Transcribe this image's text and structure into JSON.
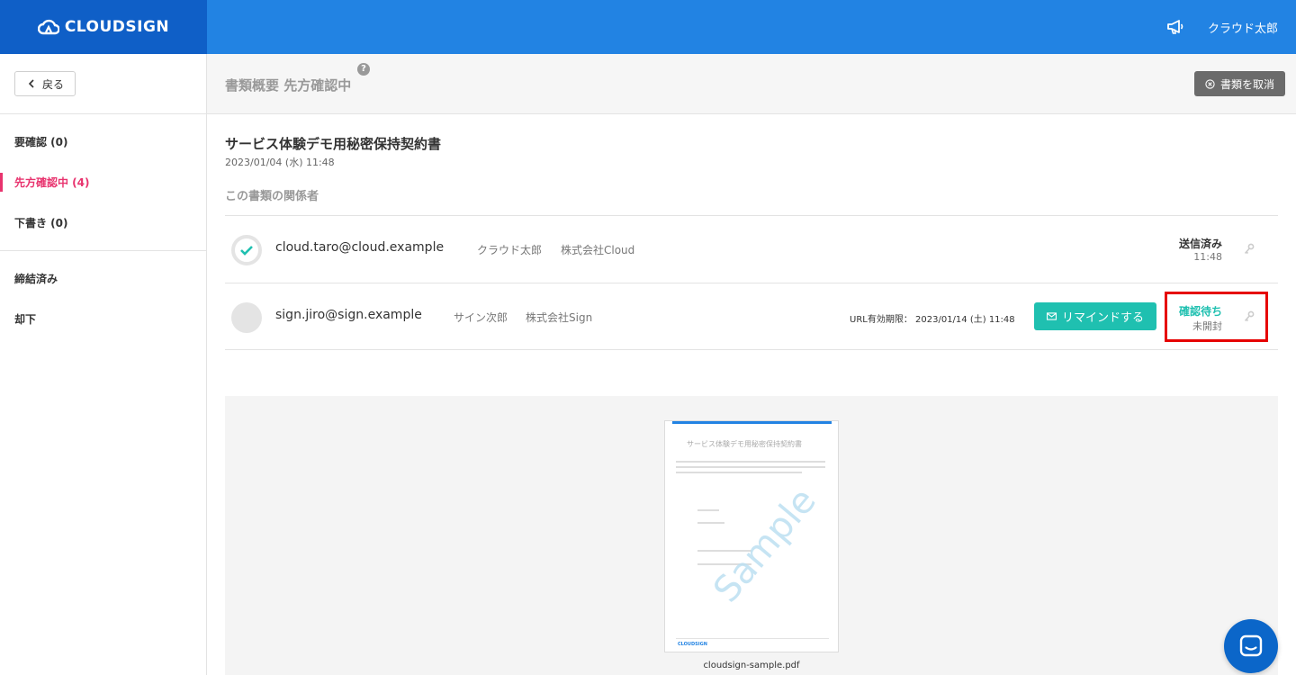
{
  "app": {
    "logo_text": "CLOUDSIGN",
    "user_name": "クラウド太郎"
  },
  "sidebar": {
    "back_label": "戻る",
    "items": [
      {
        "label": "要確認 (0)",
        "active": false
      },
      {
        "label": "先方確認中 (4)",
        "active": true
      },
      {
        "label": "下書き (0)",
        "active": false
      },
      {
        "label": "締結済み",
        "active": false
      },
      {
        "label": "却下",
        "active": false
      }
    ]
  },
  "header": {
    "title": "書類概要 先方確認中",
    "help": "?",
    "cancel_label": "書類を取消"
  },
  "document": {
    "title": "サービス体験デモ用秘密保持契約書",
    "date": "2023/01/04 (水) 11:48",
    "parties_label": "この書類の関係者",
    "parties": [
      {
        "email": "cloud.taro@cloud.example",
        "name": "クラウド太郎",
        "company": "株式会社Cloud",
        "status": "送信済み",
        "status_sub": "11:48"
      },
      {
        "email": "sign.jiro@sign.example",
        "name": "サイン次郎",
        "company": "株式会社Sign",
        "url_expiry": "URL有効期限： 2023/01/14 (土) 11:48",
        "remind_label": "リマインドする",
        "status": "確認待ち",
        "status_sub": "未開封"
      }
    ]
  },
  "preview": {
    "page_title": "サービス体験デモ用秘密保持契約書",
    "watermark": "Sample",
    "footer_logo": "CLOUDSIGN",
    "filename": "cloudsign-sample.pdf"
  },
  "colors": {
    "primary": "#2283e3",
    "logo_bg": "#0f5fc7",
    "active": "#e8336e",
    "teal": "#1fc0b0",
    "highlight": "#e60000"
  }
}
